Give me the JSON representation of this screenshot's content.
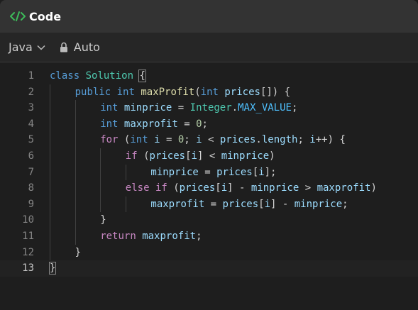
{
  "header": {
    "title": "Code",
    "icon": "code-icon"
  },
  "toolbar": {
    "language": "Java",
    "mode": "Auto"
  },
  "editor": {
    "current_line": 13,
    "lines": [
      {
        "n": "1",
        "indent": 0,
        "tokens": [
          [
            "kw",
            "class"
          ],
          [
            "punc",
            " "
          ],
          [
            "cls",
            "Solution"
          ],
          [
            "punc",
            " "
          ],
          [
            "bm",
            "{"
          ]
        ]
      },
      {
        "n": "2",
        "indent": 1,
        "tokens": [
          [
            "kw",
            "public"
          ],
          [
            "punc",
            " "
          ],
          [
            "kw",
            "int"
          ],
          [
            "punc",
            " "
          ],
          [
            "fn",
            "maxProfit"
          ],
          [
            "punc",
            "("
          ],
          [
            "kw",
            "int"
          ],
          [
            "punc",
            " "
          ],
          [
            "var",
            "prices"
          ],
          [
            "punc",
            "[]) {"
          ]
        ]
      },
      {
        "n": "3",
        "indent": 2,
        "tokens": [
          [
            "kw",
            "int"
          ],
          [
            "punc",
            " "
          ],
          [
            "var",
            "minprice"
          ],
          [
            "punc",
            " = "
          ],
          [
            "cls",
            "Integer"
          ],
          [
            "punc",
            "."
          ],
          [
            "cst",
            "MAX_VALUE"
          ],
          [
            "punc",
            ";"
          ]
        ]
      },
      {
        "n": "4",
        "indent": 2,
        "tokens": [
          [
            "kw",
            "int"
          ],
          [
            "punc",
            " "
          ],
          [
            "var",
            "maxprofit"
          ],
          [
            "punc",
            " = "
          ],
          [
            "num",
            "0"
          ],
          [
            "punc",
            ";"
          ]
        ]
      },
      {
        "n": "5",
        "indent": 2,
        "tokens": [
          [
            "ctl",
            "for"
          ],
          [
            "punc",
            " ("
          ],
          [
            "kw",
            "int"
          ],
          [
            "punc",
            " "
          ],
          [
            "var",
            "i"
          ],
          [
            "punc",
            " = "
          ],
          [
            "num",
            "0"
          ],
          [
            "punc",
            "; "
          ],
          [
            "var",
            "i"
          ],
          [
            "punc",
            " < "
          ],
          [
            "var",
            "prices"
          ],
          [
            "punc",
            "."
          ],
          [
            "var",
            "length"
          ],
          [
            "punc",
            "; "
          ],
          [
            "var",
            "i"
          ],
          [
            "punc",
            "++) {"
          ]
        ]
      },
      {
        "n": "6",
        "indent": 3,
        "tokens": [
          [
            "ctl",
            "if"
          ],
          [
            "punc",
            " ("
          ],
          [
            "var",
            "prices"
          ],
          [
            "punc",
            "["
          ],
          [
            "var",
            "i"
          ],
          [
            "punc",
            "] < "
          ],
          [
            "var",
            "minprice"
          ],
          [
            "punc",
            ")"
          ]
        ]
      },
      {
        "n": "7",
        "indent": 4,
        "tokens": [
          [
            "var",
            "minprice"
          ],
          [
            "punc",
            " = "
          ],
          [
            "var",
            "prices"
          ],
          [
            "punc",
            "["
          ],
          [
            "var",
            "i"
          ],
          [
            "punc",
            "];"
          ]
        ]
      },
      {
        "n": "8",
        "indent": 3,
        "tokens": [
          [
            "ctl",
            "else"
          ],
          [
            "punc",
            " "
          ],
          [
            "ctl",
            "if"
          ],
          [
            "punc",
            " ("
          ],
          [
            "var",
            "prices"
          ],
          [
            "punc",
            "["
          ],
          [
            "var",
            "i"
          ],
          [
            "punc",
            "] - "
          ],
          [
            "var",
            "minprice"
          ],
          [
            "punc",
            " > "
          ],
          [
            "var",
            "maxprofit"
          ],
          [
            "punc",
            ")"
          ]
        ]
      },
      {
        "n": "9",
        "indent": 4,
        "tokens": [
          [
            "var",
            "maxprofit"
          ],
          [
            "punc",
            " = "
          ],
          [
            "var",
            "prices"
          ],
          [
            "punc",
            "["
          ],
          [
            "var",
            "i"
          ],
          [
            "punc",
            "] - "
          ],
          [
            "var",
            "minprice"
          ],
          [
            "punc",
            ";"
          ]
        ]
      },
      {
        "n": "10",
        "indent": 2,
        "tokens": [
          [
            "punc",
            "}"
          ]
        ]
      },
      {
        "n": "11",
        "indent": 2,
        "tokens": [
          [
            "ctl",
            "return"
          ],
          [
            "punc",
            " "
          ],
          [
            "var",
            "maxprofit"
          ],
          [
            "punc",
            ";"
          ]
        ]
      },
      {
        "n": "12",
        "indent": 1,
        "tokens": [
          [
            "punc",
            "}"
          ]
        ]
      },
      {
        "n": "13",
        "indent": 0,
        "tokens": [
          [
            "bm",
            "}"
          ]
        ]
      }
    ]
  }
}
